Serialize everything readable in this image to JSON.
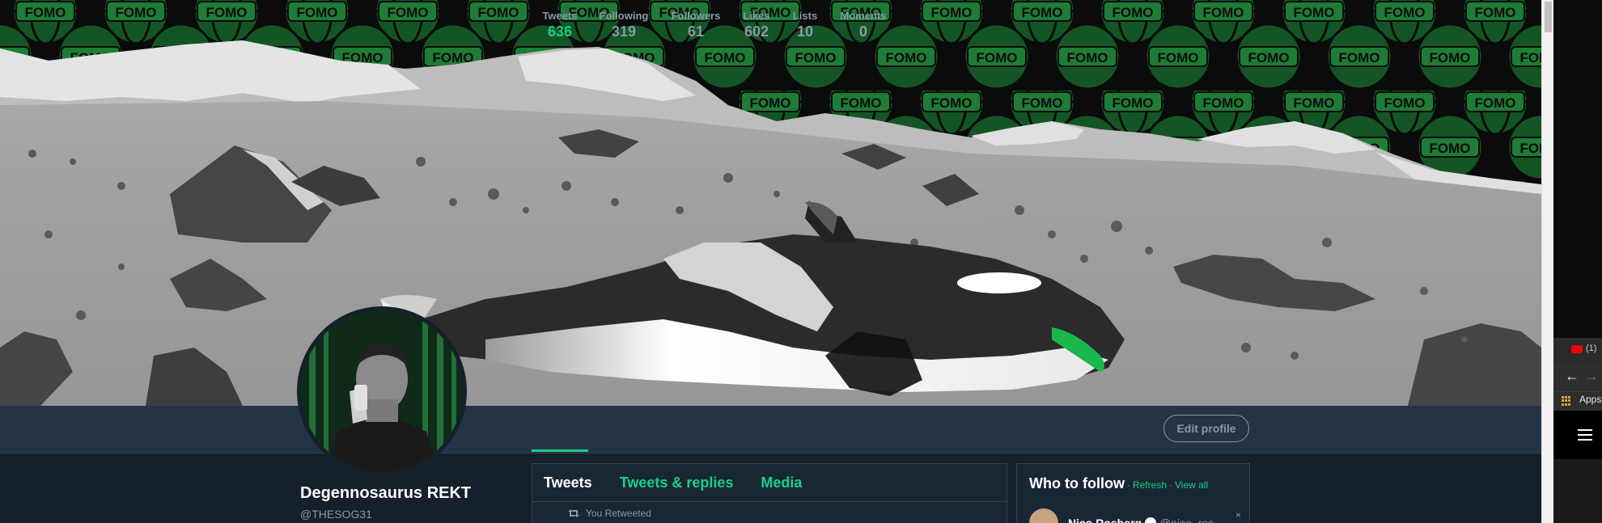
{
  "profile": {
    "name": "Degennosaurus REKT",
    "handle": "@THESOG31"
  },
  "banner": {
    "pattern_text": "FOMO"
  },
  "stats": [
    {
      "label": "Tweets",
      "value": "636",
      "active": true
    },
    {
      "label": "Following",
      "value": "319",
      "active": false
    },
    {
      "label": "Followers",
      "value": "61",
      "active": false
    },
    {
      "label": "Likes",
      "value": "602",
      "active": false
    },
    {
      "label": "Lists",
      "value": "10",
      "active": false
    },
    {
      "label": "Moments",
      "value": "0",
      "active": false
    }
  ],
  "edit_profile_label": "Edit profile",
  "timeline": {
    "tabs": [
      "Tweets",
      "Tweets & replies",
      "Media"
    ],
    "retweet_label": "You Retweeted"
  },
  "who_to_follow": {
    "title": "Who to follow",
    "dot": "·",
    "refresh": "Refresh",
    "view_all": "View all",
    "user_name": "Nico Rosberg",
    "user_handle": "@nico_ros",
    "close": "×"
  },
  "browser": {
    "youtube_count": "(1)",
    "back": "←",
    "forward": "→",
    "apps_label": "Apps"
  },
  "colors": {
    "accent": "#19cf86",
    "background": "#15202b",
    "nav_bg": "#243447",
    "banner_green": "#1f7a35"
  }
}
